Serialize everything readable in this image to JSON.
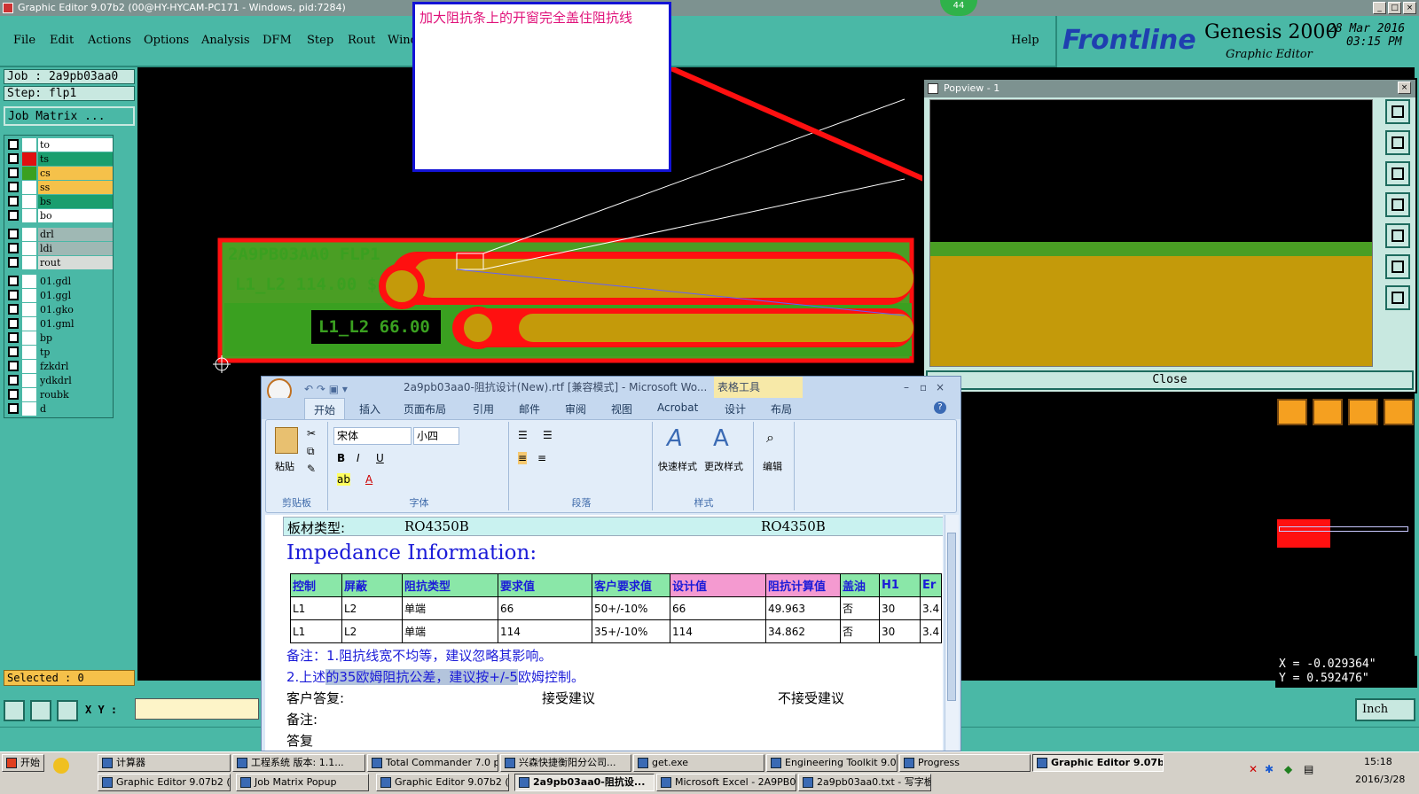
{
  "window": {
    "title": "Graphic Editor 9.07b2 (00@HY-HYCAM-PC171 - Windows, pid:7284)",
    "badge": "44"
  },
  "menu": [
    "File",
    "Edit",
    "Actions",
    "Options",
    "Analysis",
    "DFM",
    "Step",
    "Rout",
    "Wind"
  ],
  "help": "Help",
  "brand": {
    "logo": "Frontline",
    "product": "Genesis 2000",
    "sub": "Graphic Editor",
    "date": "28 Mar 2016",
    "time": "03:15 PM"
  },
  "job": {
    "job": "Job : 2a9pb03aa0",
    "step": "Step: flp1",
    "matrix_btn": "Job Matrix ..."
  },
  "layers": [
    {
      "name": "to",
      "color": "#ffffff",
      "bg": "#ffffff"
    },
    {
      "name": "ts",
      "color": "#e01010",
      "bg": "#1a9e6e"
    },
    {
      "name": "cs",
      "color": "#3aa020",
      "bg": "#f5c14a"
    },
    {
      "name": "ss",
      "color": "#ffffff",
      "bg": "#f5c14a"
    },
    {
      "name": "bs",
      "color": "#ffffff",
      "bg": "#1a9e6e"
    },
    {
      "name": "bo",
      "color": "#ffffff",
      "bg": "#ffffff"
    },
    {
      "name": "drl",
      "color": "#ffffff",
      "bg": "#9fb8b4"
    },
    {
      "name": "ldi",
      "color": "#ffffff",
      "bg": "#9fb8b4"
    },
    {
      "name": "rout",
      "color": "#ffffff",
      "bg": "#d8dcd8"
    },
    {
      "name": "01.gdl",
      "color": "#ffffff",
      "bg": "#4ab8a6"
    },
    {
      "name": "01.ggl",
      "color": "#ffffff",
      "bg": "#4ab8a6"
    },
    {
      "name": "01.gko",
      "color": "#ffffff",
      "bg": "#4ab8a6"
    },
    {
      "name": "01.gml",
      "color": "#ffffff",
      "bg": "#4ab8a6"
    },
    {
      "name": "bp",
      "color": "#ffffff",
      "bg": "#4ab8a6"
    },
    {
      "name": "tp",
      "color": "#ffffff",
      "bg": "#4ab8a6"
    },
    {
      "name": "fzkdrl",
      "color": "#ffffff",
      "bg": "#4ab8a6"
    },
    {
      "name": "ydkdrl",
      "color": "#ffffff",
      "bg": "#4ab8a6"
    },
    {
      "name": "roubk",
      "color": "#ffffff",
      "bg": "#4ab8a6"
    },
    {
      "name": "d",
      "color": "#ffffff",
      "bg": "#4ab8a6"
    }
  ],
  "selected": "Selected : 0",
  "annotation": "加大阻抗条上的开窗完全盖住阻抗线",
  "board": {
    "label1": "2A9PB03AA0 FLP1",
    "label2": "L1_L2 114.00 $",
    "label3": "L1_L2 66.00 $"
  },
  "popview": {
    "title": "Popview - 1",
    "close": "Close"
  },
  "coords": {
    "x": "X = -0.029364\"",
    "y": "Y =  0.592476\""
  },
  "xy_label": "X Y :",
  "units": "Inch",
  "word": {
    "title": "2a9pb03aa0-阻抗设计(New).rtf [兼容模式] - Microsoft Wo...",
    "tools": "表格工具",
    "tabs": [
      "开始",
      "插入",
      "页面布局",
      "引用",
      "邮件",
      "审阅",
      "视图",
      "Acrobat",
      "设计",
      "布局"
    ],
    "font": "宋体",
    "size": "小四",
    "groups": {
      "clipboard": "剪贴板",
      "paste": "粘贴",
      "font": "字体",
      "para": "段落",
      "styles": "样式",
      "quick": "快速样式",
      "change": "更改样式",
      "edit": "编辑"
    },
    "material_label": "板材类型:",
    "material_v1": "RO4350B",
    "material_v2": "RO4350B",
    "heading": "Impedance Information:",
    "headers": [
      "控制",
      "屏蔽",
      "阻抗类型",
      "要求值",
      "客户要求值",
      "设计值",
      "阻抗计算值",
      "盖油",
      "H1",
      "Er"
    ],
    "rows": [
      [
        "L1",
        "L2",
        "单端",
        "66",
        "50+/-10%",
        "66",
        "49.963",
        "否",
        "30",
        "3.4"
      ],
      [
        "L1",
        "L2",
        "单端",
        "114",
        "35+/-10%",
        "114",
        "34.862",
        "否",
        "30",
        "3.4"
      ]
    ],
    "note1": "备注：1.阻抗线宽不均等，建议忽略其影响。",
    "note2a": "2.上述",
    "note2b": "的35欧姆阻抗公差，建议按+/-5",
    "note2c": "欧姆控制。",
    "reply": "客户答复:",
    "accept": "接受建议",
    "reject": "不接受建议",
    "note3": "备注:",
    "note4": "答复"
  },
  "taskbar": {
    "start": "开始",
    "row1": [
      "计算器",
      "工程系统  版本: 1.1...",
      "Total Commander 7.0 p...",
      "兴森快捷衡阳分公司...",
      "get.exe",
      "Engineering Toolkit 9.0...",
      "Progress",
      "Graphic Editor 9.07b2 (..."
    ],
    "row2": [
      "Graphic Editor 9.07b2 (0...",
      "Job Matrix Popup",
      "Graphic Editor 9.07b2 (0...",
      "2a9pb03aa0-阻抗设...",
      "Microsoft Excel - 2A9PB0...",
      "2a9pb03aa0.txt - 写字板"
    ],
    "time": "15:18",
    "date": "2016/3/28"
  }
}
